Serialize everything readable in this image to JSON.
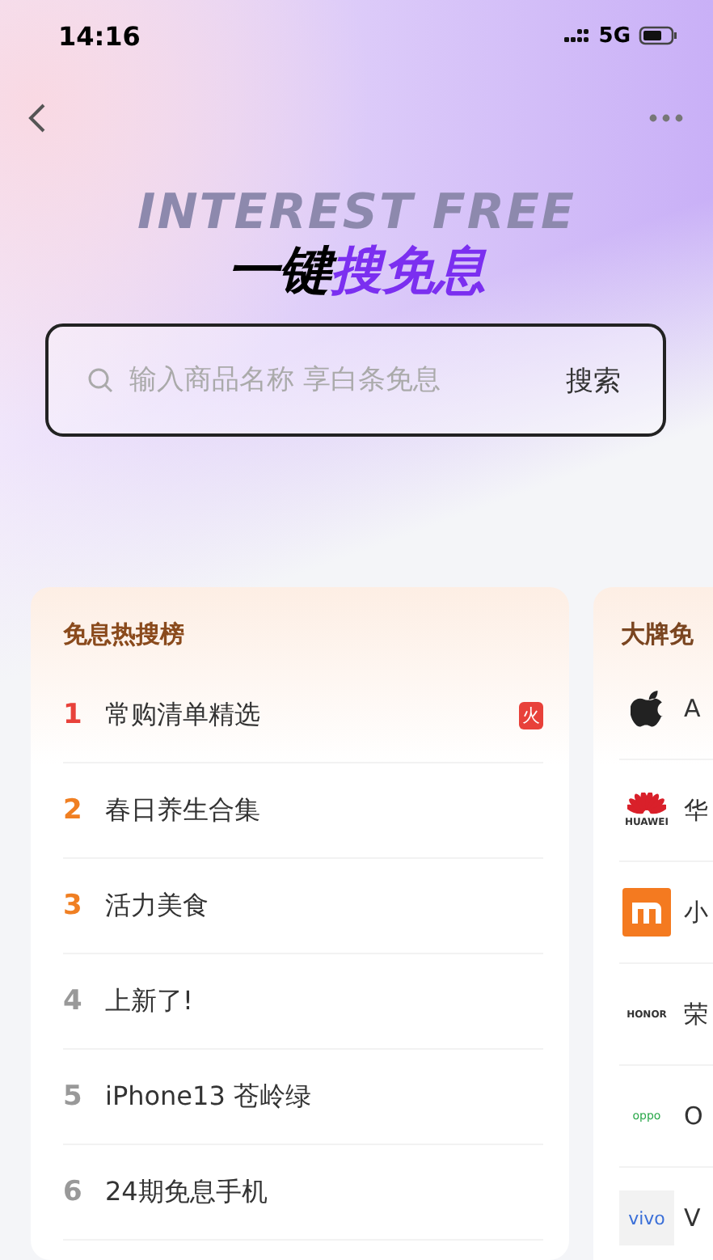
{
  "status_bar": {
    "time": "14:16",
    "network": "5G"
  },
  "hero": {
    "title_plain": "一键",
    "title_accent": "搜免息",
    "backdrop_text": "INTEREST FREE"
  },
  "search": {
    "placeholder": "输入商品名称 享白条免息",
    "button": "搜索"
  },
  "hot_list": {
    "title": "免息热搜榜",
    "items": [
      {
        "rank": "1",
        "label": "常购清单精选",
        "color": "#e8413a",
        "badge": "火"
      },
      {
        "rank": "2",
        "label": "春日养生合集",
        "color": "#f07f22"
      },
      {
        "rank": "3",
        "label": "活力美食",
        "color": "#f07f22"
      },
      {
        "rank": "4",
        "label": "上新了!",
        "color": "#999999"
      },
      {
        "rank": "5",
        "label": "iPhone13 苍岭绿",
        "color": "#999999"
      },
      {
        "rank": "6",
        "label": "24期免息手机",
        "color": "#999999"
      }
    ]
  },
  "brand_list": {
    "title": "大牌免",
    "items": [
      {
        "kind": "apple",
        "name": "A"
      },
      {
        "kind": "huawei",
        "logo_text": "HUAWEI",
        "name": "华"
      },
      {
        "kind": "mi",
        "name": "小"
      },
      {
        "kind": "honor",
        "logo_text": "HONOR",
        "name": "荣"
      },
      {
        "kind": "oppo",
        "logo_text": "oppo",
        "name": "O"
      },
      {
        "kind": "vivo",
        "logo_text": "vivo",
        "name": "V"
      }
    ]
  }
}
